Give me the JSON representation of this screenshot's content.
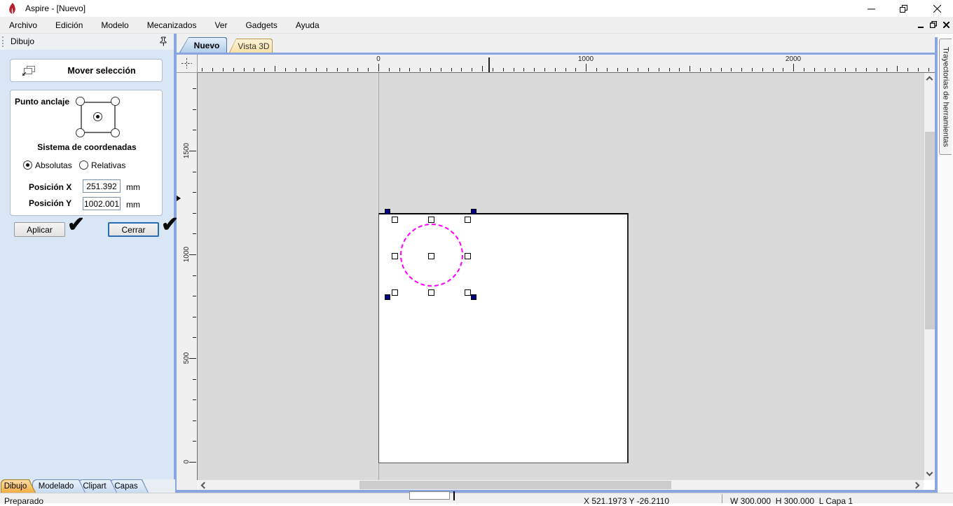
{
  "window": {
    "title": "Aspire - [Nuevo]"
  },
  "menu": {
    "items": [
      "Archivo",
      "Edición",
      "Modelo",
      "Mecanizados",
      "Ver",
      "Gadgets",
      "Ayuda"
    ]
  },
  "drawing_panel": {
    "header": "Dibujo",
    "tool_header": "Mover selección",
    "anchor_label": "Punto anclaje",
    "coord_system_label": "Sistema de coordenadas",
    "radio_absolute": "Absolutas",
    "radio_relative": "Relativas",
    "pos_x_label": "Posición X",
    "pos_x_value": "251.392",
    "pos_y_label": "Posición Y",
    "pos_y_value": "1002.001",
    "unit_x": "mm",
    "unit_y": "mm",
    "apply_button": "Aplicar",
    "close_button": "Cerrar"
  },
  "view_tabs": {
    "tab_new": "Nuevo",
    "tab_3d": "Vista 3D"
  },
  "rulers": {
    "horizontal_labels": [
      "0",
      "1000",
      "2000"
    ],
    "vertical_labels": [
      "1500",
      "1000",
      "500",
      "0"
    ]
  },
  "right_tab": {
    "label": "Trayectorias de herramientas"
  },
  "bottom_tabs": {
    "drawing": "Dibujo",
    "modeling": "Modelado",
    "clipart": "Clipart",
    "layers": "Capas"
  },
  "status_bar": {
    "left": "Preparado",
    "cursor": "X 521.1973 Y -26.2110",
    "dims": "W 300.000  H 300.000  L Capa 1"
  },
  "icons": {
    "apply_check": "✔",
    "close_check": "✔"
  },
  "colors": {
    "frame_blue": "#8aa5e0",
    "selection_magenta": "#ff00ff",
    "handle_navy": "#000080",
    "active_tab_orange": "#f2ad42",
    "app_icon_red": "#b5202e"
  }
}
